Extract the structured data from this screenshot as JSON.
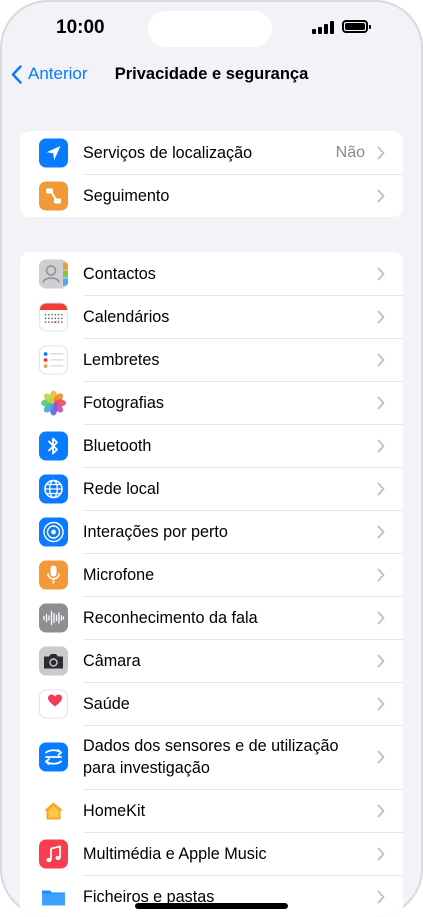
{
  "status": {
    "time": "10:00"
  },
  "nav": {
    "back_label": "Anterior",
    "title": "Privacidade e segurança"
  },
  "colors": {
    "accent": "#0a7aff",
    "background": "#f2f2f7"
  },
  "group1": [
    {
      "label": "Serviços de localização",
      "value": "Não",
      "icon": "location-arrow-icon",
      "color": "#0a7aff"
    },
    {
      "label": "Seguimento",
      "icon": "tracking-icon",
      "color": "#f19a37"
    }
  ],
  "group2": [
    {
      "label": "Contactos",
      "icon": "contacts-icon"
    },
    {
      "label": "Calendários",
      "icon": "calendar-icon"
    },
    {
      "label": "Lembretes",
      "icon": "reminders-icon"
    },
    {
      "label": "Fotografias",
      "icon": "photos-icon"
    },
    {
      "label": "Bluetooth",
      "icon": "bluetooth-icon",
      "color": "#0a7aff"
    },
    {
      "label": "Rede local",
      "icon": "globe-icon",
      "color": "#0a7aff"
    },
    {
      "label": "Interações por perto",
      "icon": "nearby-interactions-icon",
      "color": "#0a7aff"
    },
    {
      "label": "Microfone",
      "icon": "microphone-icon",
      "color": "#f19a37"
    },
    {
      "label": "Reconhecimento da fala",
      "icon": "speech-waveform-icon",
      "color": "#8e8e93"
    },
    {
      "label": "Câmara",
      "icon": "camera-icon",
      "color": "#8e8e93"
    },
    {
      "label": "Saúde",
      "icon": "health-heart-icon"
    },
    {
      "label": "Dados dos sensores e de utilização para investigação",
      "icon": "research-sensor-icon",
      "color": "#0a7aff"
    },
    {
      "label": "HomeKit",
      "icon": "home-icon"
    },
    {
      "label": "Multimédia e Apple Music",
      "icon": "music-note-icon",
      "color": "#fa3c51"
    },
    {
      "label": "Ficheiros e pastas",
      "icon": "folder-icon",
      "color": "#1a8cff"
    }
  ]
}
